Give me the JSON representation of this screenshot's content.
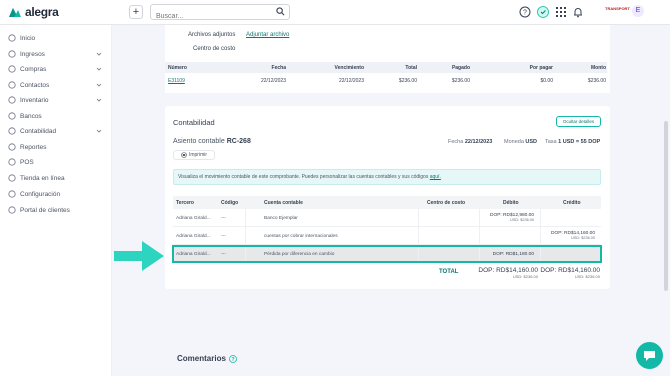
{
  "app": {
    "name": "alegra"
  },
  "topbar": {
    "add_label": "+",
    "search_placeholder": "Buscar...",
    "company": "TRANSPORT",
    "avatar_initial": "E"
  },
  "sidebar": {
    "items": [
      {
        "label": "Inicio",
        "icon": "home-icon",
        "expandable": false
      },
      {
        "label": "Ingresos",
        "icon": "income-icon",
        "expandable": true
      },
      {
        "label": "Compras",
        "icon": "purchases-icon",
        "expandable": true
      },
      {
        "label": "Contactos",
        "icon": "contacts-icon",
        "expandable": true
      },
      {
        "label": "Inventario",
        "icon": "inventory-icon",
        "expandable": true
      },
      {
        "label": "Bancos",
        "icon": "bank-icon",
        "expandable": false
      },
      {
        "label": "Contabilidad",
        "icon": "accounting-icon",
        "expandable": true
      },
      {
        "label": "Reportes",
        "icon": "reports-icon",
        "expandable": false
      },
      {
        "label": "POS",
        "icon": "pos-icon",
        "expandable": false
      },
      {
        "label": "Tienda en línea",
        "icon": "store-icon",
        "expandable": false
      },
      {
        "label": "Configuración",
        "icon": "settings-icon",
        "expandable": false
      },
      {
        "label": "Portal de clientes",
        "icon": "portal-icon",
        "expandable": false
      }
    ]
  },
  "details": {
    "attachments_label": "Archivos adjuntos",
    "attach_link": "Adjuntar archivo",
    "cost_center_label": "Centro de costo"
  },
  "payments_table": {
    "headers": [
      "Número",
      "Fecha",
      "Vencimiento",
      "Total",
      "Pagado",
      "Por pagar",
      "Monto"
    ],
    "rows": [
      [
        "E31109",
        "22/12/2023",
        "22/12/2023",
        "$236.00",
        "$236.00",
        "$0.00",
        "$236.00"
      ]
    ]
  },
  "accounting": {
    "title": "Contabilidad",
    "hide_details": "Ocultar detalles",
    "entry_prefix": "Asiento contable",
    "entry_number": "RC-268",
    "date_label": "Fecha",
    "date_value": "22/12/2023",
    "currency_label": "Moneda",
    "currency_value": "USD",
    "rate_label": "Tasa",
    "rate_value": "1 USD = 55 DOP",
    "print_label": "Imprimir",
    "info_text": "Visualiza el movimiento contable de este comprobante. Puedes personalizar las cuentas contables y sus códigos",
    "info_link": "aquí.",
    "headers": [
      "Tercero",
      "Código",
      "Cuenta contable",
      "Centro de costo",
      "Débito",
      "Crédito"
    ],
    "rows": [
      {
        "tercero": "Adriana Girald...",
        "codigo": "---",
        "cuenta": "Banco Ejemplar",
        "centro": "",
        "debito": "DOP: RD$12,980.00",
        "debito_usd": "USD: $236.00",
        "credito": "",
        "credito_usd": ""
      },
      {
        "tercero": "Adriana Girald...",
        "codigo": "---",
        "cuenta": "cuentas por cobrar internacionales",
        "centro": "",
        "debito": "",
        "debito_usd": "",
        "credito": "DOP: RD$14,160.00",
        "credito_usd": "USD: $236.00"
      },
      {
        "tercero": "Adriana Girald...",
        "codigo": "---",
        "cuenta": "Pérdida por diferencia en cambio",
        "centro": "",
        "debito": "DOP: RD$1,180.00",
        "debito_usd": "",
        "credito": "",
        "credito_usd": ""
      }
    ],
    "total_label": "TOTAL",
    "total_debit": "DOP: RD$14,160.00",
    "total_debit_usd": "USD: $236.00",
    "total_credit": "DOP: RD$14,160.00",
    "total_credit_usd": "USD: $236.00"
  },
  "comments": {
    "title": "Comentarios"
  },
  "colors": {
    "accent": "#14b8a6",
    "link": "#0f766e",
    "highlight_row": "#e7e8ea"
  }
}
